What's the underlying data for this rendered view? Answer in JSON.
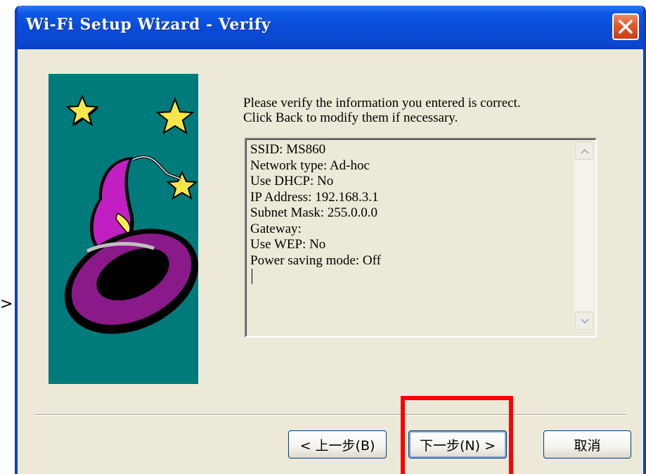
{
  "window": {
    "title": "Wi-Fi Setup Wizard - Verify",
    "close_icon": "close-icon"
  },
  "instructions": {
    "line1": "Please verify the information you entered is correct.",
    "line2": "Click Back to modify them if necessary."
  },
  "summary": {
    "lines": [
      "SSID: MS860",
      "Network type: Ad-hoc",
      "Use DHCP: No",
      "IP Address: 192.168.3.1",
      "Subnet Mask: 255.0.0.0",
      "Gateway:",
      "Use WEP: No",
      "Power saving mode: Off"
    ]
  },
  "buttons": {
    "back": "< 上一步(B)",
    "next": "下一步(N) >",
    "cancel": "取消"
  },
  "colors": {
    "titlebar": "#0a4ad8",
    "panel_background": "#007a7a",
    "highlight": "#ff0000"
  }
}
